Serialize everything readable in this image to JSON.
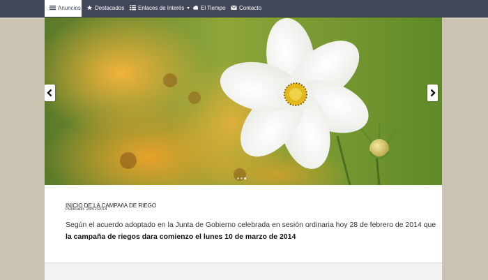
{
  "nav": {
    "items": [
      {
        "label": "Anuncios",
        "icon": "list-icon"
      },
      {
        "label": "Destacados",
        "icon": "star-icon"
      },
      {
        "label": "Enlaces de Interés",
        "icon": "table-list-icon"
      },
      {
        "label": "El Tiempo",
        "icon": "cloud-icon"
      },
      {
        "label": "Contacto",
        "icon": "envelope-icon"
      }
    ],
    "active_item": "Anuncios"
  },
  "carousel": {
    "slide_count": 3,
    "active_slide": 3,
    "prev_icon": "chevron-left-icon",
    "next_icon": "chevron-right-icon"
  },
  "article": {
    "title": "INICIO DE LA CAMPAñA DE RIEGO",
    "date": "Publicado: 28/02/2014",
    "body_intro": "Según el acuerdo adoptado en la Junta de Gobierno celebrada en sesión ordinaria hoy 28 de febrero de 2014 que ",
    "body_bold": "la campaña de riegos dara comienzo el lunes 10 de marzo de 2014"
  },
  "colors": {
    "navbar": "#42475a",
    "page_background": "#ccc4b2",
    "content_background": "#ffffff"
  }
}
